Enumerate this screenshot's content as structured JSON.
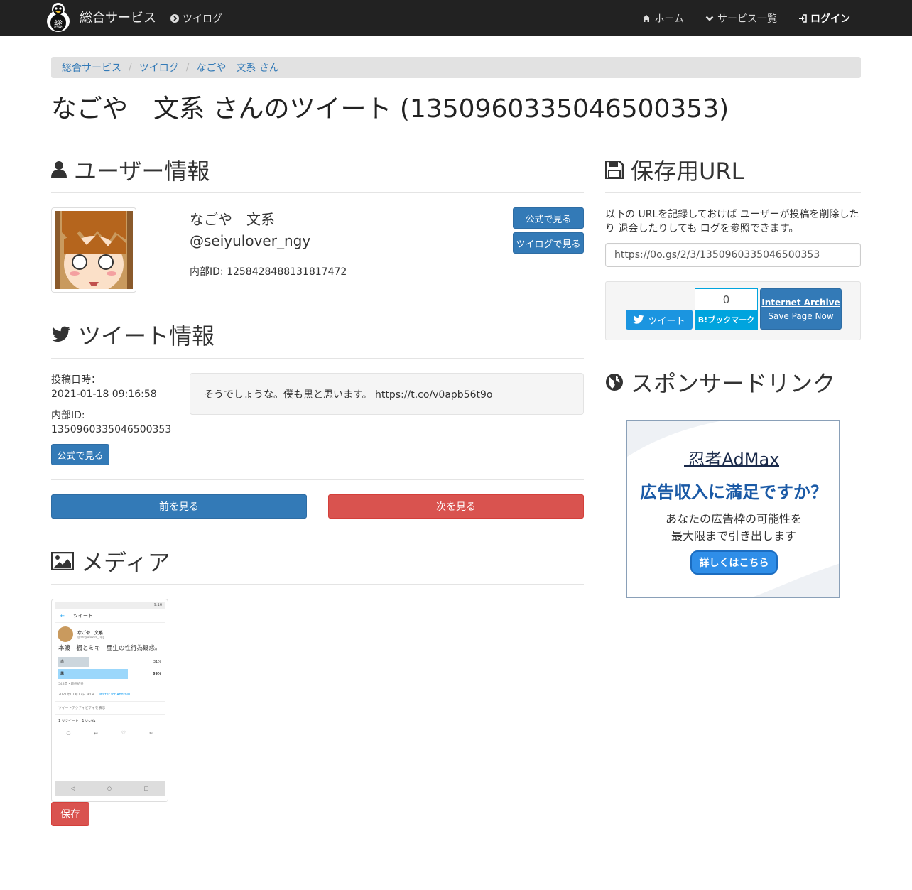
{
  "navbar": {
    "brand": "総合サービス",
    "tsuilog": "ツイログ",
    "home": "ホーム",
    "services": "サービス一覧",
    "login": "ログイン"
  },
  "breadcrumb": [
    "総合サービス",
    "ツイログ",
    "なごや　文系 さん"
  ],
  "page_title": "なごや　文系 さんのツイート (1350960335046500353)",
  "user_section": {
    "heading": "ユーザー情報",
    "name": "なごや　文系",
    "handle": "@seiyulover_ngy",
    "internal_id": "内部ID: 1258428488131817472",
    "btn_official": "公式で見る",
    "btn_tsuilog": "ツイログで見る"
  },
  "tweet_section": {
    "heading": "ツイート情報",
    "posted_label": "投稿日時：",
    "posted_value": "2021-01-18 09:16:58",
    "id_label": "内部ID:",
    "id_value": "1350960335046500353",
    "btn_official": "公式で見る",
    "text": "そうでしょうな。僕も黒と思います。 https://t.co/v0apb56t9o"
  },
  "nav_buttons": {
    "prev": "前を見る",
    "next": "次を見る"
  },
  "media_section": {
    "heading": "メディア",
    "save": "保存",
    "screenshot": {
      "header": "ツイート",
      "name": "なごや　文系",
      "handle": "@seiyulover_ngy",
      "body": "本渡　楓とミキ　亜生の性行為疑惑。",
      "poll": [
        {
          "label": "白",
          "percent": "31%",
          "fraction": 0.31
        },
        {
          "label": "黒",
          "percent": "69%",
          "fraction": 0.69
        }
      ],
      "poll_meta": "548票・最終結果",
      "date": "2021年01月17日 9:04",
      "client": "Twitter for Android",
      "activity": "ツイートアクティビティを表示",
      "stats": "1 リツイート　1 いいね",
      "status_time": "9:16"
    }
  },
  "save_url_section": {
    "heading": "保存用URL",
    "description": "以下の URLを記録しておけば ユーザーが投稿を削除したり 退会したりしても ログを参照できます。",
    "url": "https://0o.gs/2/3/1350960335046500353",
    "tweet_btn": "ツイート",
    "bookmark_count": "0",
    "bookmark_label": "B!ブックマーク",
    "archive_title": "Internet Archive",
    "archive_sub": "Save Page Now"
  },
  "sponsor_section": {
    "heading": "スポンサードリンク",
    "ad_brand": "忍者AdMax",
    "ad_headline": "広告収入に満足ですか？",
    "ad_line1": "あなたの広告枠の可能性を",
    "ad_line2": "最大限まで引き出します",
    "ad_button": "詳しくはこちら"
  },
  "colors": {
    "navbar_bg": "#222222",
    "primary": "#337ab7",
    "danger": "#d9534f",
    "twitter": "#1b95e0",
    "hatena": "#00a4de"
  }
}
